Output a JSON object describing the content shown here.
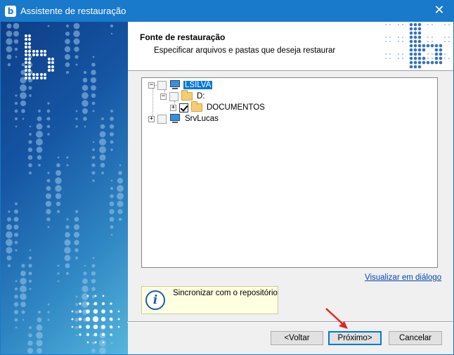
{
  "window": {
    "title": "Assistente de restauração",
    "app_icon": "b",
    "close_glyph": "✕",
    "accent": "#1979ca"
  },
  "header": {
    "title": "Fonte de restauração",
    "subtitle": "Especificar arquivos e pastas que deseja restaurar"
  },
  "tree": {
    "nodes": [
      {
        "label": "LSILVA",
        "icon": "computer-icon",
        "expander": "−",
        "checked": false,
        "selected": true
      },
      {
        "label": "D:",
        "icon": "folder-icon",
        "expander": "−",
        "checked": false,
        "selected": false
      },
      {
        "label": "DOCUMENTOS",
        "icon": "folder-icon",
        "expander": "+",
        "checked": true,
        "selected": false
      },
      {
        "label": "SrvLucas",
        "icon": "computer-icon",
        "expander": "+",
        "checked": false,
        "selected": false
      }
    ]
  },
  "link": {
    "label": "Visualizar em diálogo"
  },
  "info": {
    "icon": "info-icon",
    "text": "Sincronizar com o repositório"
  },
  "buttons": {
    "back": "<Voltar",
    "next": "Próximo>",
    "cancel": "Cancelar"
  },
  "annotation": {
    "icon": "red-arrow-icon",
    "color": "#e32424"
  }
}
